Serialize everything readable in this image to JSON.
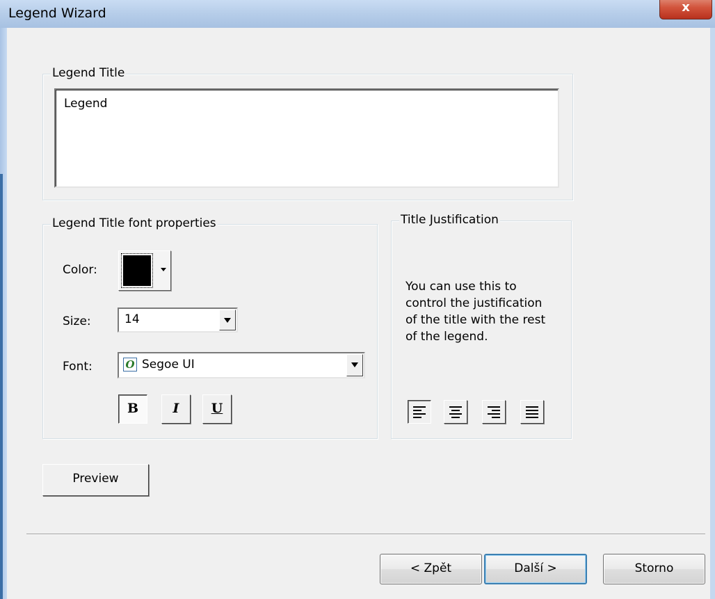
{
  "window": {
    "title": "Legend Wizard",
    "close_glyph": "x"
  },
  "legend_title_group": {
    "label": "Legend Title",
    "value": "Legend"
  },
  "font_group": {
    "label": "Legend Title font properties",
    "color_label": "Color:",
    "color_value": "#000000",
    "size_label": "Size:",
    "size_value": "14",
    "font_label": "Font:",
    "font_value": "Segoe UI",
    "font_icon": "opentype-font-icon",
    "bold_label": "B",
    "italic_label": "I",
    "underline_label": "U"
  },
  "justification_group": {
    "label": "Title Justification",
    "description": "You can use this to control the justification of the title with the rest of the legend.",
    "options": [
      "align-left-icon",
      "align-center-icon",
      "align-right-icon",
      "align-justify-icon"
    ],
    "selected": "align-left-icon"
  },
  "preview_label": "Preview",
  "footer": {
    "back_label": "< Zpět",
    "next_label": "Další >",
    "cancel_label": "Storno"
  }
}
